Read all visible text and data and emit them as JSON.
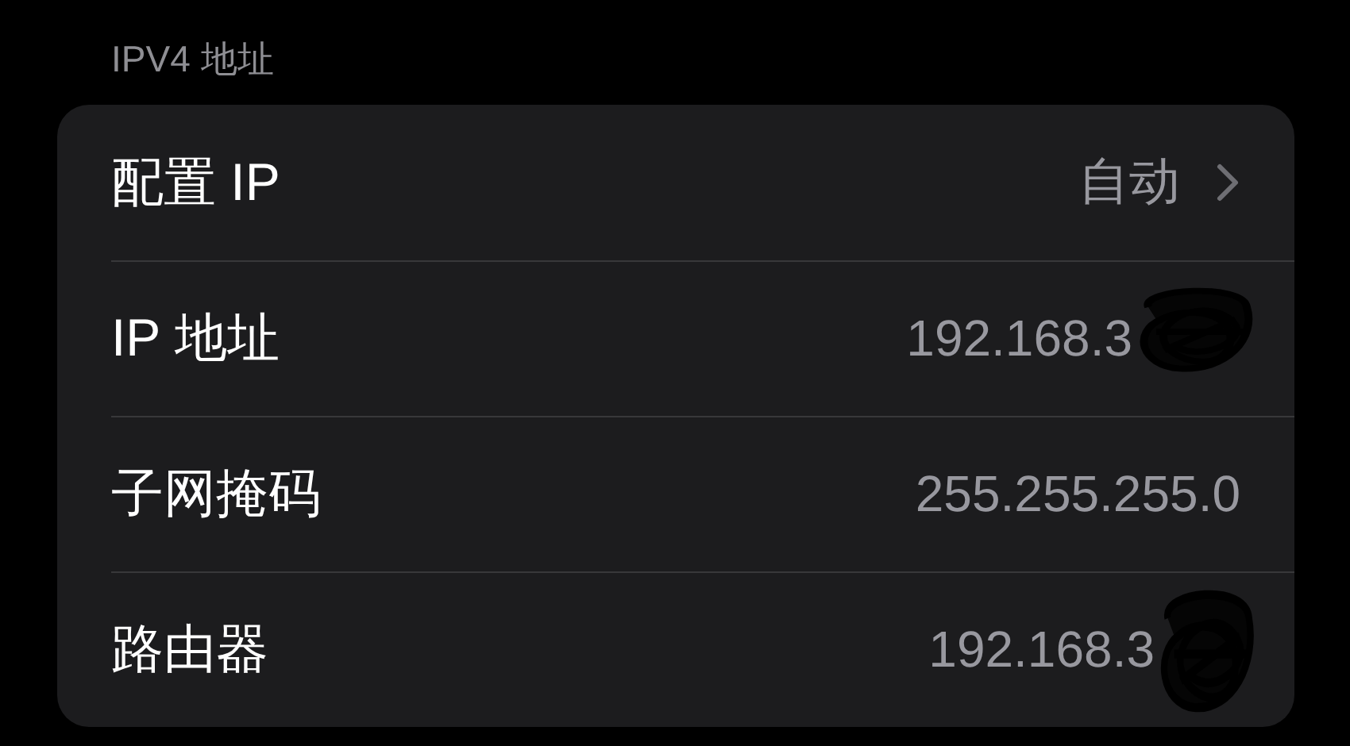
{
  "section_header": "IPV4 地址",
  "rows": [
    {
      "label": "配置 IP",
      "value": "自动",
      "kind": "disclosure",
      "redacted": false
    },
    {
      "label": "IP 地址",
      "value": "192.168.3",
      "kind": "info",
      "redacted": true
    },
    {
      "label": "子网掩码",
      "value": "255.255.255.0",
      "kind": "info",
      "redacted": false
    },
    {
      "label": "路由器",
      "value": "192.168.3",
      "kind": "info",
      "redacted": true
    }
  ]
}
